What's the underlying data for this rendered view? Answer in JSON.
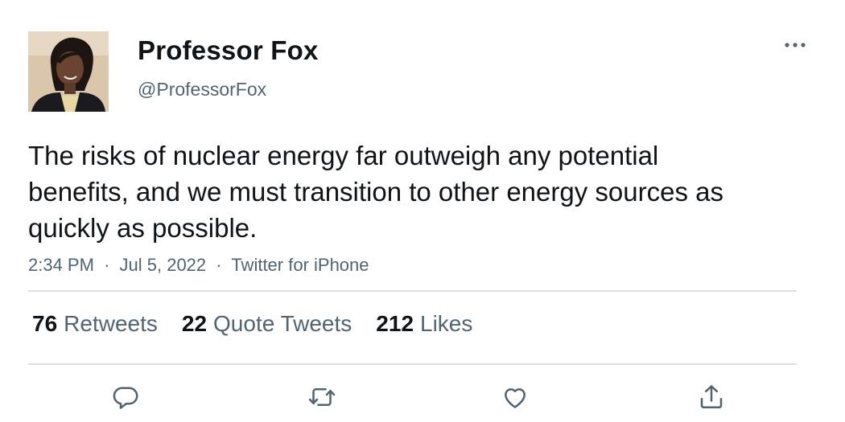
{
  "author": {
    "display_name": "Professor Fox",
    "handle": "@ProfessorFox"
  },
  "tweet": {
    "text": "The risks of nuclear energy far outweigh any potential benefits, and we must transition to other energy sources as quickly as possible.",
    "time": "2:34 PM",
    "date": "Jul 5, 2022",
    "source": "Twitter for iPhone",
    "separator": "·"
  },
  "stats": {
    "retweets_count": "76",
    "retweets_label": "Retweets",
    "quote_tweets_count": "22",
    "quote_tweets_label": "Quote Tweets",
    "likes_count": "212",
    "likes_label": "Likes"
  },
  "actions": [
    "reply-icon",
    "retweet-icon",
    "like-icon",
    "share-icon"
  ],
  "colors": {
    "text_primary": "#0f1419",
    "text_secondary": "#536471",
    "divider": "#dcdfe3",
    "icon": "#536471"
  }
}
